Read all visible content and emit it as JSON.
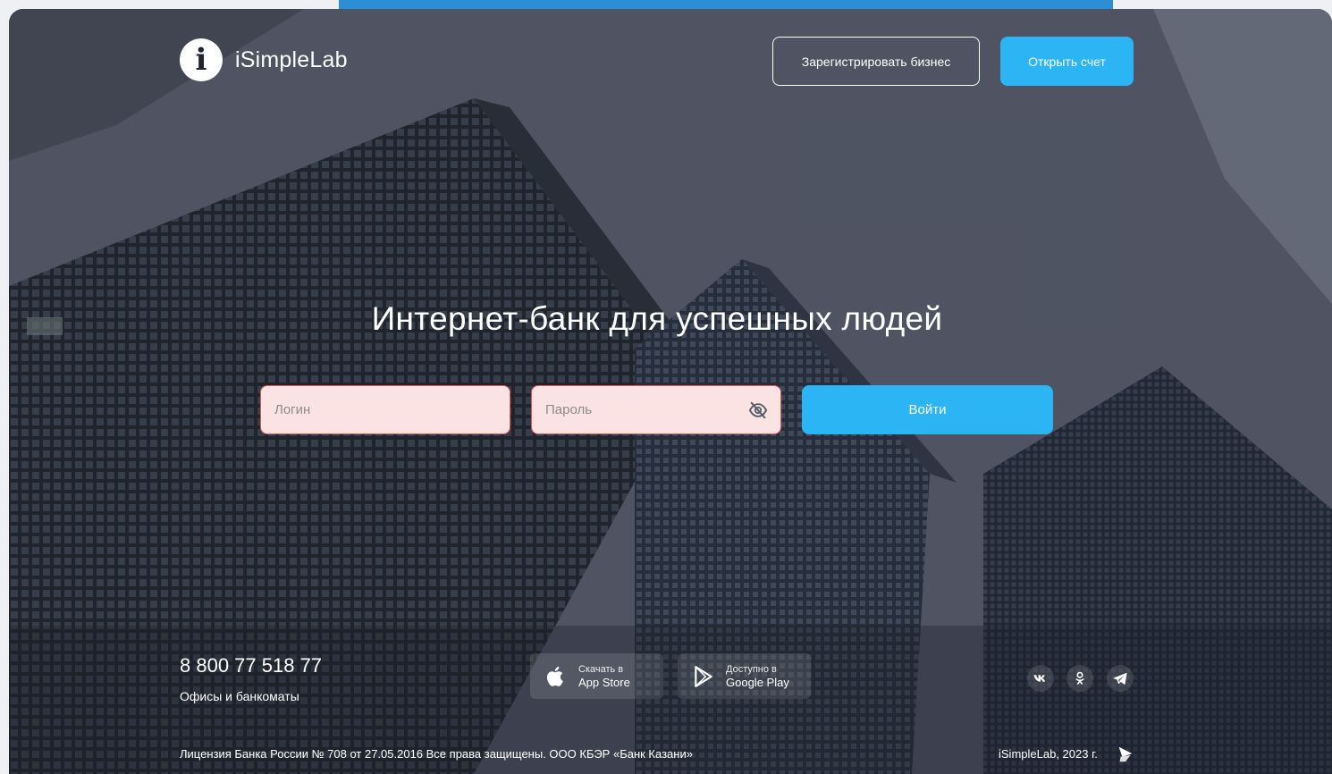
{
  "header": {
    "brand_name": "iSimpleLab",
    "logo_letter": "i",
    "register_label": "Зарегистрировать бизнес",
    "open_account_label": "Открыть счет"
  },
  "hero": {
    "title": "Интернет-банк для успешных людей",
    "login_placeholder": "Логин",
    "password_placeholder": "Пароль",
    "submit_label": "Войти",
    "password_toggle_icon": "eye-off-icon"
  },
  "footer": {
    "phone": "8 800 77 518 77",
    "offices_label": "Офисы и банкоматы",
    "app_store": {
      "small": "Скачать в",
      "big": "App Store",
      "icon": "apple-icon"
    },
    "google_play": {
      "small": "Доступно в",
      "big": "Google Play",
      "icon": "play-icon"
    },
    "socials": [
      "vk-icon",
      "odnoklassniki-icon",
      "telegram-icon"
    ],
    "license": "Лицензия Банка России № 708 от 27.05.2016 Все права защищены. ООО КБЭР «Банк Казани»",
    "copyright": "iSimpleLab, 2023 г."
  },
  "colors": {
    "accent": "#2bb5f5",
    "field_error_bg": "#fbe3e3",
    "field_error_border": "#e35a5a",
    "top_strip": "#2a8fd3"
  }
}
